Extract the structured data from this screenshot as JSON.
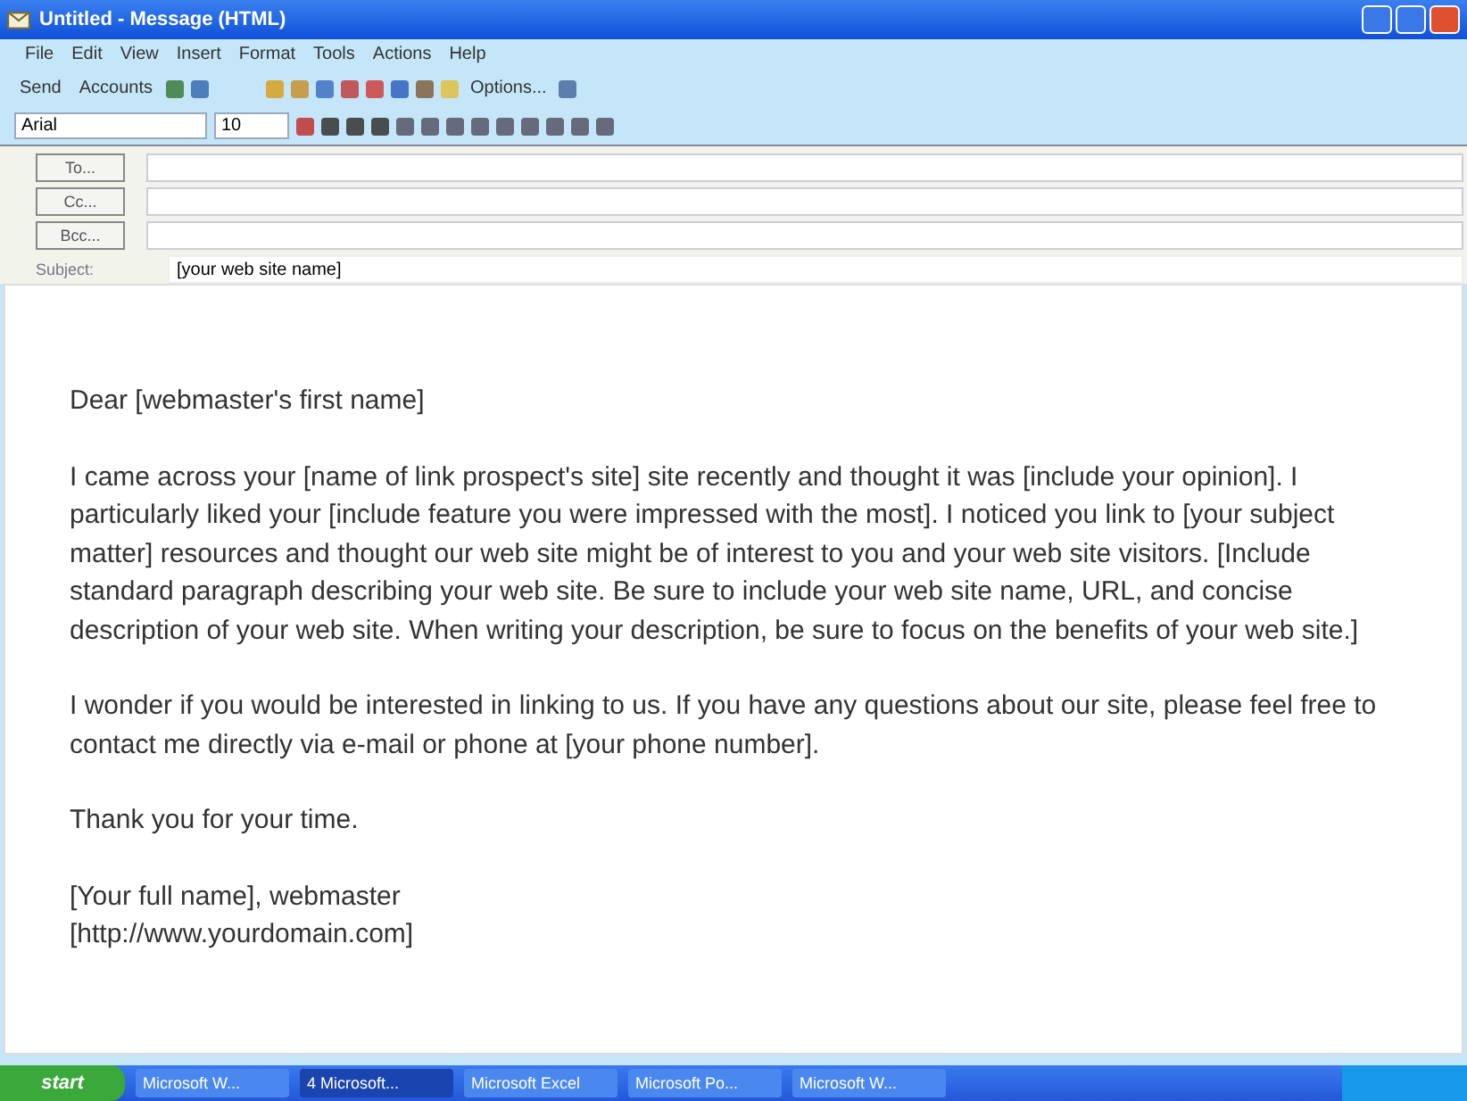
{
  "window": {
    "title": "Untitled - Message (HTML)"
  },
  "menu": [
    "File",
    "Edit",
    "View",
    "Insert",
    "Format",
    "Tools",
    "Actions",
    "Help"
  ],
  "toolbar": {
    "send": "Send",
    "accounts": "Accounts",
    "options": "Options..."
  },
  "format_bar": {
    "font": "Arial",
    "size": "10"
  },
  "header": {
    "fields": [
      {
        "button": "To..."
      },
      {
        "button": "Cc..."
      },
      {
        "button": "Bcc..."
      }
    ],
    "subject_label": "Subject:",
    "subject": "[your web site name]"
  },
  "body": [
    "Dear [webmaster's first name]",
    "I came across your [name of link prospect's site] site recently and thought it was [include your opinion]. I particularly liked your [include feature you were impressed with the most]. I noticed you link to [your subject matter] resources and thought our web site might be of interest to you and your web site visitors. [Include standard paragraph describing your web site. Be sure to include your web site name, URL, and concise description of your web site. When writing your description, be sure to focus on the benefits of your web site.]",
    "I wonder if you would be interested in linking to us. If you have any questions about our site, please feel free to contact me directly via e-mail or phone at [your phone number].",
    "Thank you for your time.",
    "[Your full name], webmaster\n[http://www.yourdomain.com]"
  ],
  "taskbar": {
    "start": "start",
    "items": [
      {
        "label": "Microsoft W...",
        "selected": false
      },
      {
        "label": "4 Microsoft...",
        "selected": true
      },
      {
        "label": "Microsoft Excel",
        "selected": false
      },
      {
        "label": "Microsoft Po...",
        "selected": false
      },
      {
        "label": "Microsoft W...",
        "selected": false
      }
    ]
  }
}
